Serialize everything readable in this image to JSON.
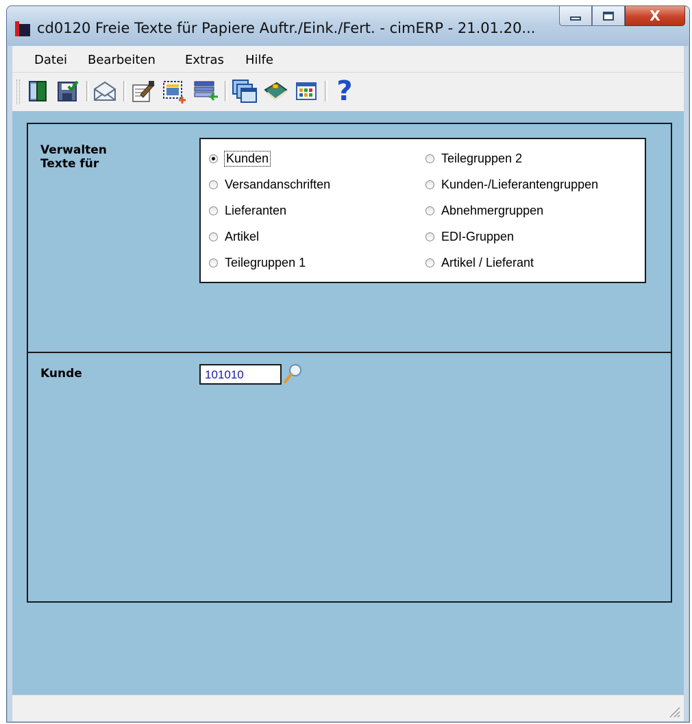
{
  "window": {
    "title": "cd0120 Freie Texte für Papiere Auftr./Eink./Fert. - cimERP - 21.01.20...",
    "close_symbol": "X"
  },
  "menu": {
    "items": [
      {
        "label": "Datei"
      },
      {
        "label": "Bearbeiten"
      },
      {
        "label": "Extras"
      },
      {
        "label": "Hilfe"
      }
    ]
  },
  "toolbar": {
    "buttons": [
      {
        "icon": "exit-door-icon"
      },
      {
        "icon": "save-icon"
      },
      {
        "icon": "mail-icon"
      },
      {
        "icon": "edit-text-icon"
      },
      {
        "icon": "new-record-icon"
      },
      {
        "icon": "import-list-icon"
      },
      {
        "icon": "windows-icon"
      },
      {
        "icon": "book-icon"
      },
      {
        "icon": "grid-icon"
      },
      {
        "icon": "help-icon"
      }
    ],
    "help_symbol": "?"
  },
  "form": {
    "section_label": "Verwalten Texte für",
    "section_label_line1": "Verwalten",
    "section_label_line2": "Texte für",
    "options_left": [
      "Kunden",
      "Versandanschriften",
      "Lieferanten",
      "Artikel",
      "Teilegruppen 1"
    ],
    "options_right": [
      "Teilegruppen 2",
      "Kunden-/Lieferantengruppen",
      "Abnehmergruppen",
      "EDI-Gruppen",
      "Artikel / Lieferant"
    ],
    "selected_option": "Kunden",
    "customer_label": "Kunde",
    "customer_value": "101010"
  },
  "colors": {
    "workarea_bg": "#98c1da",
    "input_text": "#1a1aaa",
    "close_button": "#c7442a"
  }
}
